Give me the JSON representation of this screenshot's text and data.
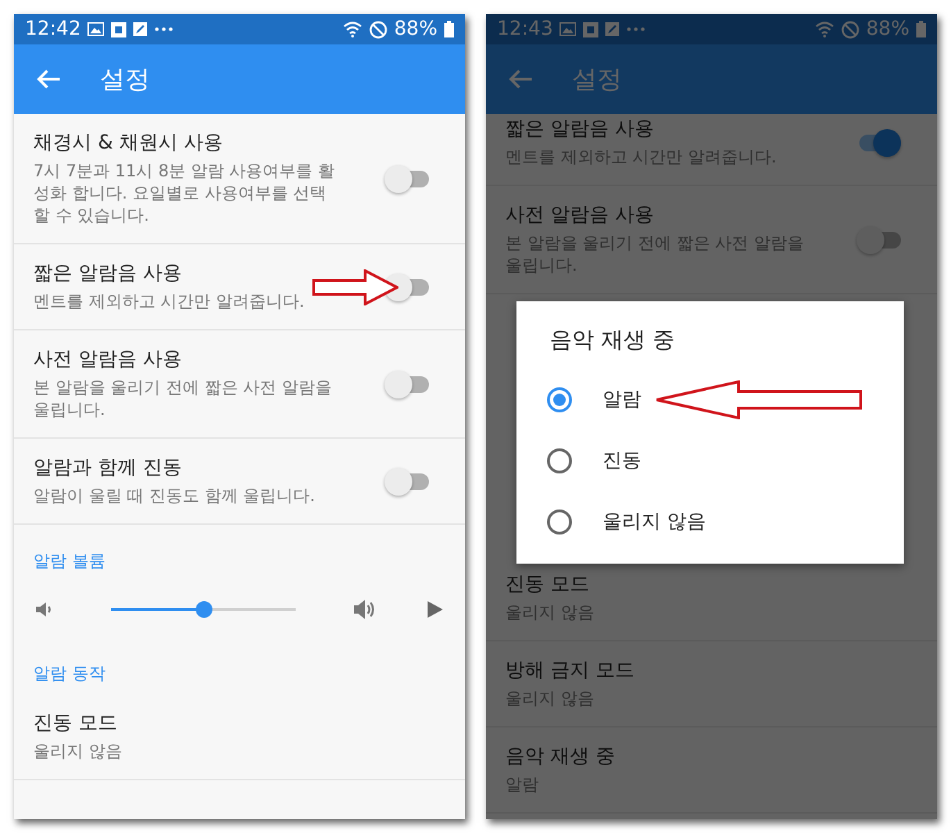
{
  "screens": [
    {
      "status_bar": {
        "time": "12:42",
        "battery": "88%"
      },
      "app_bar": {
        "title": "설정"
      },
      "dimmed": false,
      "items": [
        {
          "kind": "toggle",
          "title": "채경시 & 채원시 사용",
          "subtitle": "7시 7분과 11시 8분 알람 사용여부를 활성화 합니다. 요일별로 사용여부를 선택할 수 있습니다.",
          "on": false,
          "marked": false
        },
        {
          "kind": "toggle",
          "title": "짧은 알람음 사용",
          "subtitle": "멘트를 제외하고 시간만 알려줍니다.",
          "on": false,
          "marked": true
        },
        {
          "kind": "toggle",
          "title": "사전 알람음 사용",
          "subtitle": "본 알람을 울리기 전에 짧은 사전 알람을 울립니다.",
          "on": false,
          "marked": false
        },
        {
          "kind": "toggle",
          "title": "알람과 함께 진동",
          "subtitle": "알람이 울릴 때 진동도 함께 울립니다.",
          "on": false,
          "marked": false
        },
        {
          "kind": "section",
          "title": "알람 볼륨"
        },
        {
          "kind": "slider",
          "level": 0.5
        },
        {
          "kind": "section",
          "title": "알람 동작"
        },
        {
          "kind": "value",
          "title": "진동 모드",
          "subtitle": "울리지 않음"
        }
      ]
    },
    {
      "status_bar": {
        "time": "12:43",
        "battery": "88%"
      },
      "app_bar": {
        "title": "설정"
      },
      "dimmed": true,
      "items": [
        {
          "kind": "toggle",
          "title": "짧은 알람음 사용",
          "subtitle": "멘트를 제외하고 시간만 알려줍니다.",
          "on": true,
          "marked": false
        },
        {
          "kind": "toggle",
          "title": "사전 알람음 사용",
          "subtitle": "본 알람을 울리기 전에 짧은 사전 알람을 울립니다.",
          "on": false,
          "marked": false
        },
        {
          "kind": "hidden"
        },
        {
          "kind": "value",
          "title": "진동 모드",
          "subtitle": "울리지 않음"
        },
        {
          "kind": "value",
          "title": "방해 금지 모드",
          "subtitle": "울리지 않음"
        },
        {
          "kind": "value",
          "title": "음악 재생 중",
          "subtitle": "알람"
        }
      ],
      "dialog": {
        "title": "음악 재생 중",
        "options": [
          {
            "label": "알람",
            "selected": true,
            "marked": true
          },
          {
            "label": "진동",
            "selected": false,
            "marked": false
          },
          {
            "label": "울리지 않음",
            "selected": false,
            "marked": false
          }
        ]
      }
    }
  ]
}
